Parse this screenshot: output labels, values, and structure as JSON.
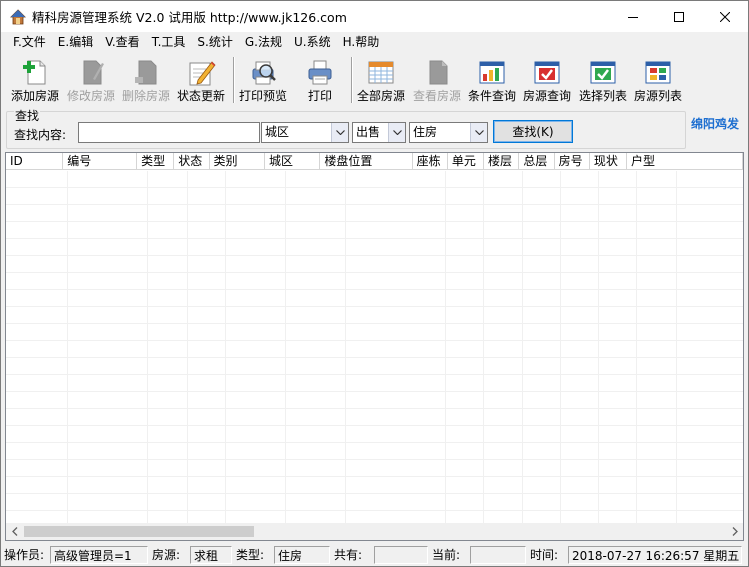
{
  "window": {
    "title": "精科房源管理系统 V2.0  试用版 http://www.jk126.com"
  },
  "menu": [
    {
      "label": "F.文件"
    },
    {
      "label": "E.编辑"
    },
    {
      "label": "V.查看"
    },
    {
      "label": "T.工具"
    },
    {
      "label": "S.统计"
    },
    {
      "label": "G.法规"
    },
    {
      "label": "U.系统"
    },
    {
      "label": "H.帮助"
    }
  ],
  "toolbar": {
    "add": "添加房源",
    "edit": "修改房源",
    "delete": "删除房源",
    "status": "状态更新",
    "preview": "打印预览",
    "print": "打印",
    "all": "全部房源",
    "view": "查看房源",
    "cond_query": "条件查询",
    "house_query": "房源查询",
    "select_list": "选择列表",
    "house_list": "房源列表"
  },
  "search": {
    "legend": "查找",
    "label": "查找内容:",
    "value": "",
    "district": "城区",
    "trade": "出售",
    "type": "住房",
    "button": "查找(K)"
  },
  "brand": "绵阳鸡发",
  "table": {
    "columns": [
      "ID",
      "编号",
      "类型",
      "状态",
      "类别",
      "城区",
      "楼盘位置",
      "座栋",
      "单元",
      "楼层",
      "总层",
      "房号",
      "现状",
      "户型"
    ]
  },
  "status": {
    "operator_label": "操作员:",
    "operator": "高级管理员=1",
    "source_label": "房源:",
    "source": "求租",
    "type_label": "类型:",
    "type": "住房",
    "total_label": "共有:",
    "total": "",
    "current_label": "当前:",
    "current": "",
    "time_label": "时间:",
    "time": "2018-07-27  16:26:57  星期五"
  }
}
